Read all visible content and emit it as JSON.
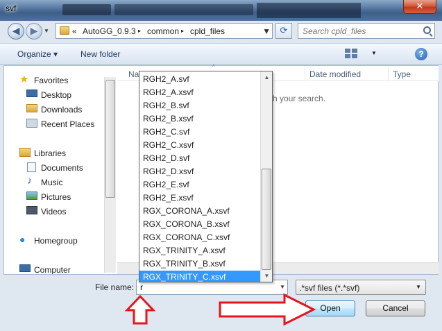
{
  "window": {
    "title": "svf",
    "close_glyph": "✕"
  },
  "address_bar": {
    "prefix": "«",
    "segments": [
      "AutoGG_0.9.3",
      "common",
      "cpld_files"
    ],
    "separator": "▸"
  },
  "search": {
    "placeholder": "Search cpld_files"
  },
  "toolbar": {
    "organize_label": "Organize ▾",
    "new_folder_label": "New folder",
    "help_glyph": "?"
  },
  "navigation": {
    "favorites": {
      "header": "Favorites",
      "items": [
        "Desktop",
        "Downloads",
        "Recent Places"
      ]
    },
    "libraries": {
      "header": "Libraries",
      "items": [
        "Documents",
        "Music",
        "Pictures",
        "Videos"
      ]
    },
    "homegroup": "Homegroup",
    "computer": "Computer"
  },
  "columns": {
    "name": "Na",
    "date_modified": "Date modified",
    "type": "Type"
  },
  "empty_message": "ch your search.",
  "autocomplete": {
    "items": [
      "RGH2_A.svf",
      "RGH2_A.xsvf",
      "RGH2_B.svf",
      "RGH2_B.xsvf",
      "RGH2_C.svf",
      "RGH2_C.xsvf",
      "RGH2_D.svf",
      "RGH2_D.xsvf",
      "RGH2_E.svf",
      "RGH2_E.xsvf",
      "RGX_CORONA_A.xsvf",
      "RGX_CORONA_B.xsvf",
      "RGX_CORONA_C.xsvf",
      "RGX_TRINITY_A.xsvf",
      "RGX_TRINITY_B.xsvf",
      "RGX_TRINITY_C.xsvf"
    ],
    "selected_index": 15
  },
  "file_name": {
    "label": "File name:",
    "value": "r"
  },
  "file_type": {
    "selected": ".*svf files (*.*svf)"
  },
  "buttons": {
    "open": "Open",
    "cancel": "Cancel"
  },
  "colors": {
    "selection": "#3399ff",
    "annotation_red": "#e8131c"
  }
}
